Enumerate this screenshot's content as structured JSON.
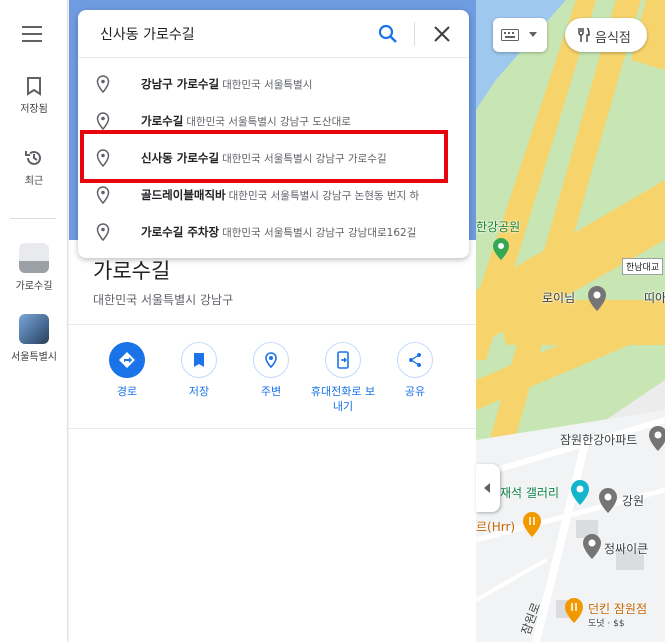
{
  "rail": {
    "items": [
      {
        "label": "저장됨",
        "icon": "bookmark-icon"
      },
      {
        "label": "최근",
        "icon": "history-icon"
      },
      {
        "label": "가로수길",
        "icon": "place-thumbnail"
      },
      {
        "label": "서울특별시",
        "icon": "city-thumbnail"
      }
    ]
  },
  "search": {
    "value": "신사동 가로수길"
  },
  "suggestions": [
    {
      "main": "강남구 가로수길",
      "secondary": "대한민국 서울특별시"
    },
    {
      "main": "가로수길",
      "secondary": "대한민국 서울특별시 강남구 도산대로"
    },
    {
      "main": "신사동 가로수길",
      "secondary": "대한민국 서울특별시 강남구 가로수길"
    },
    {
      "main": "골드레이블매직바",
      "secondary": "대한민국 서울특별시 강남구 논현동 번지 하"
    },
    {
      "main": "가로수길 주차장",
      "secondary": "대한민국 서울특별시 강남구 강남대로162길"
    }
  ],
  "place": {
    "title": "가로수길",
    "subtitle": "대한민국 서울특별시 강남구"
  },
  "actions": [
    {
      "label": "경로",
      "icon": "directions-icon"
    },
    {
      "label": "저장",
      "icon": "bookmark-icon"
    },
    {
      "label": "주변",
      "icon": "nearby-icon"
    },
    {
      "label": "휴대전화로 보내기",
      "icon": "send-to-phone-icon"
    },
    {
      "label": "공유",
      "icon": "share-icon"
    }
  ],
  "map": {
    "chip_label": "음식점",
    "labels": {
      "park": "한강공원",
      "hannam_bridge": "한남대교",
      "loinim": "로이님",
      "ddi": "띠아",
      "apartment": "잠원한강아파트",
      "gallery": "재석 갤러리",
      "gangwon": "강원",
      "hrr": "르(Hrr)",
      "jungsai": "정싸이큰",
      "jamwon_road": "잠원로",
      "restaurant": "던킨 잠원점",
      "restaurant_sub": "도넛 · $$"
    }
  },
  "colors": {
    "accent": "#1a73e8",
    "highlight": "#e8060c",
    "road": "#f7d36b",
    "park": "#c8e6b3",
    "water": "#9fc8ee"
  }
}
